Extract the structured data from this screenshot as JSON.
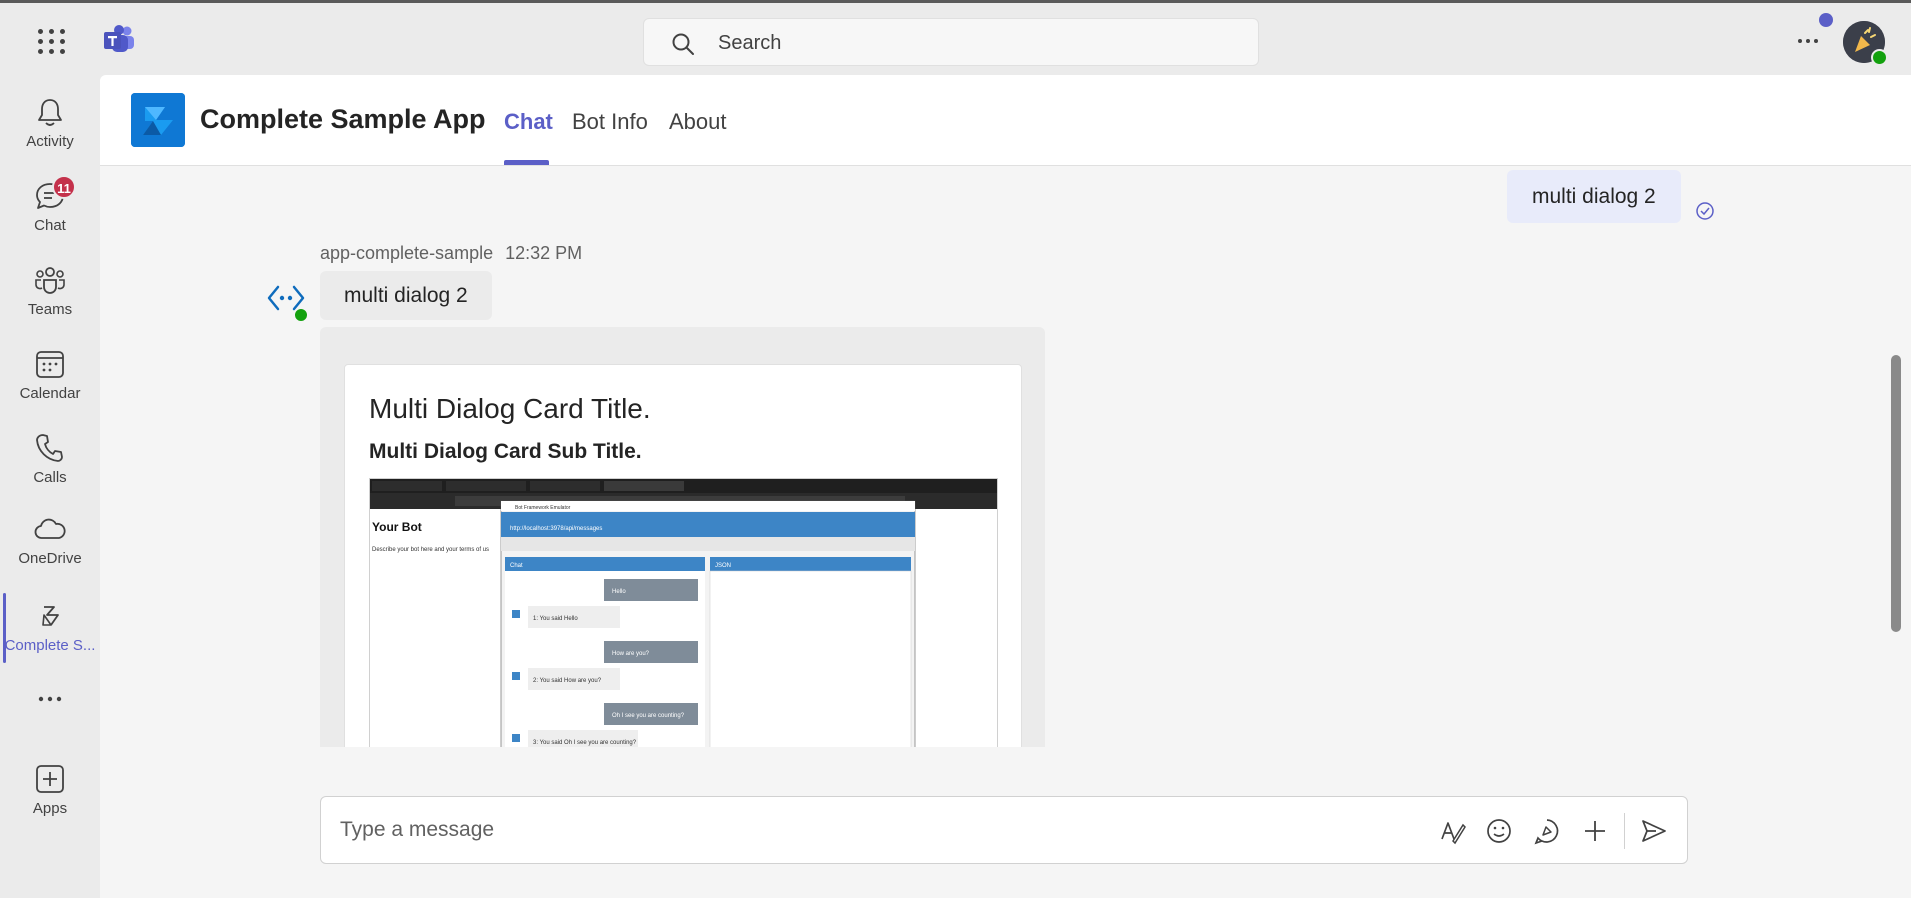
{
  "search": {
    "placeholder": "Search"
  },
  "rail": {
    "items": [
      {
        "label": "Activity",
        "icon": "bell-icon"
      },
      {
        "label": "Chat",
        "icon": "chat-icon",
        "badge": "11"
      },
      {
        "label": "Teams",
        "icon": "teams-icon"
      },
      {
        "label": "Calendar",
        "icon": "calendar-icon"
      },
      {
        "label": "Calls",
        "icon": "phone-icon"
      },
      {
        "label": "OneDrive",
        "icon": "cloud-icon"
      },
      {
        "label": "Complete S...",
        "icon": "app-icon",
        "active": true
      },
      {
        "label": "",
        "icon": "more-icon"
      },
      {
        "label": "Apps",
        "icon": "plus-square-icon"
      }
    ]
  },
  "app": {
    "title": "Complete Sample App",
    "tabs": [
      {
        "label": "Chat",
        "active": true
      },
      {
        "label": "Bot Info"
      },
      {
        "label": "About"
      }
    ]
  },
  "messages": {
    "my_message": "multi dialog 2",
    "bot_name": "app-complete-sample",
    "bot_time": "12:32 PM",
    "bot_message": "multi dialog 2"
  },
  "card": {
    "title": "Multi Dialog Card Title.",
    "subtitle": "Multi Dialog Card Sub Title.",
    "image": {
      "page_heading": "Your Bot",
      "page_text": "Describe your bot here and your terms of us",
      "emulator_title": "Bot Framework Emulator",
      "url": "http://localhost:3978/api/messages",
      "chat_label": "Chat",
      "json_label": "JSON",
      "chat_lines": [
        "Hello",
        "1: You said Hello",
        "How are you?",
        "2: You said How are you?",
        "Oh I see you are counting?",
        "3: You said Oh I see you are counting?"
      ]
    }
  },
  "compose": {
    "placeholder": "Type a message"
  },
  "colors": {
    "accent": "#5b5fc7",
    "badge": "#c4314b",
    "presence": "#13a10e",
    "app_logo": "#0f78d4"
  }
}
